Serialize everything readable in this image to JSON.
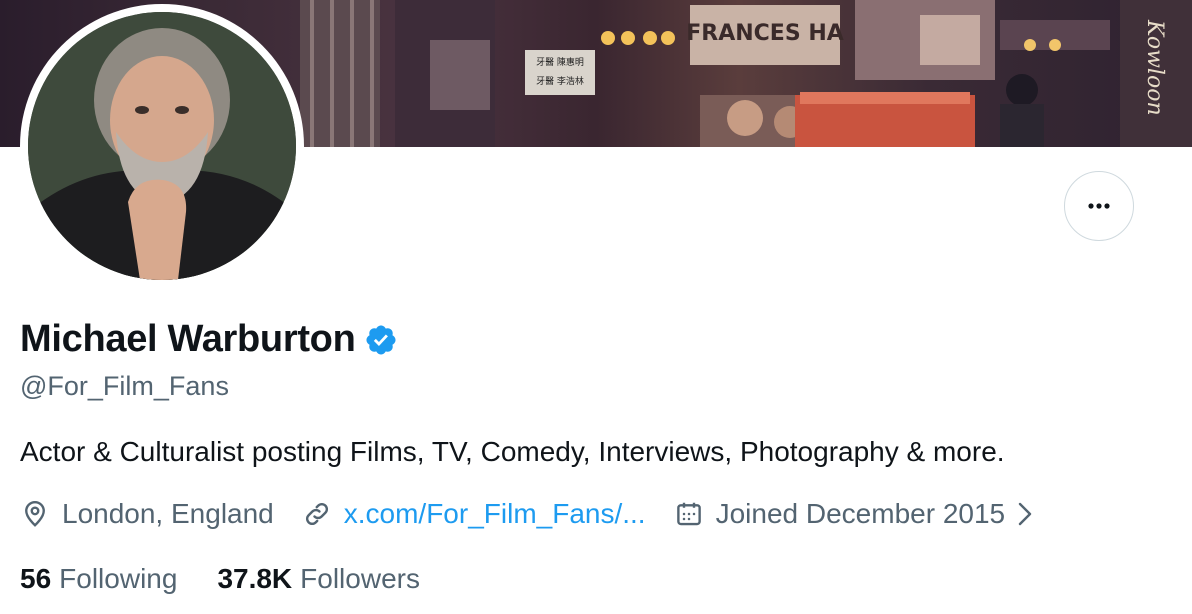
{
  "profile": {
    "name": "Michael Warburton",
    "handle": "@For_Film_Fans",
    "bio": "Actor & Culturalist posting Films, TV, Comedy, Interviews, Photography & more.",
    "location": "London, England",
    "website": "x.com/For_Film_Fans/...",
    "joined": "Joined December 2015"
  },
  "stats": {
    "following_count": "56",
    "following_label": "Following",
    "followers_count": "37.8K",
    "followers_label": "Followers"
  },
  "banner": {
    "sign_frances": "FRANCES HA",
    "sign_dr1": "牙醫 陳惠明",
    "sign_dr2": "牙醫 李浩林",
    "side_text": "Kowloon"
  },
  "icons": {
    "verified": "verified-badge-icon",
    "more": "more-options-icon",
    "location": "location-pin-icon",
    "link": "link-icon",
    "calendar": "calendar-icon",
    "chevron": "chevron-right-icon"
  },
  "colors": {
    "accent": "#1d9bf0",
    "text_primary": "#0f1419",
    "text_secondary": "#536471",
    "border": "#cfd9de"
  }
}
